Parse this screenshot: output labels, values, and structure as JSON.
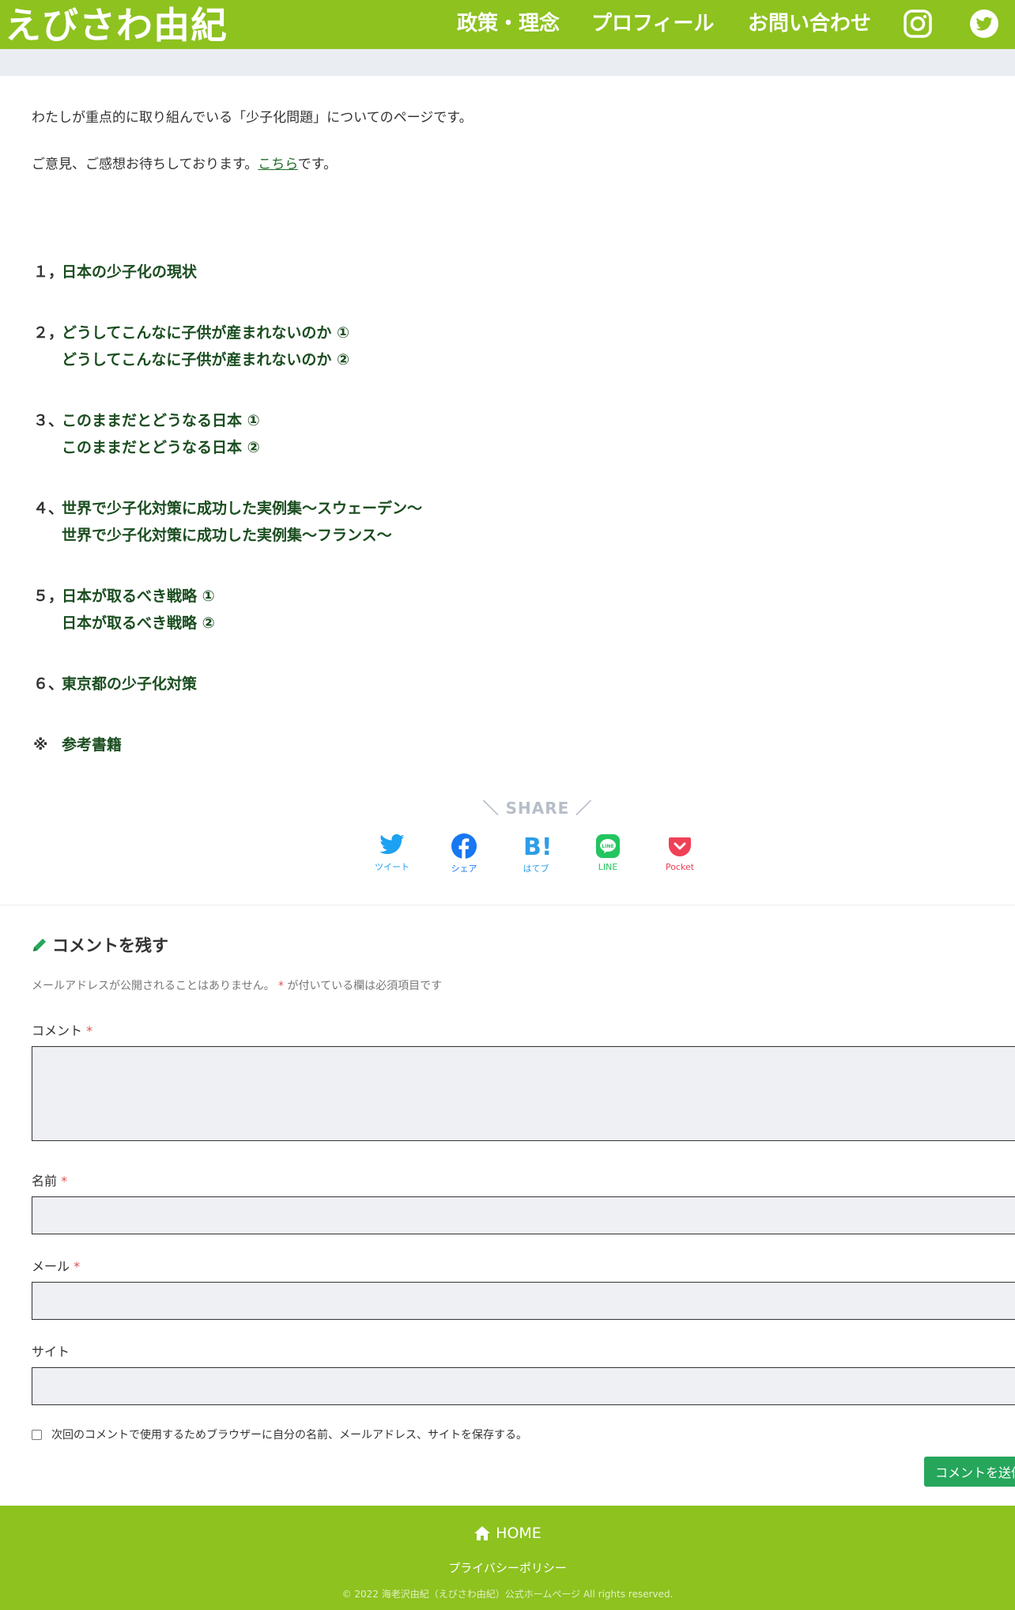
{
  "header": {
    "logo": "えびさわ由紀",
    "nav": [
      {
        "label": "政策・理念"
      },
      {
        "label": "プロフィール"
      },
      {
        "label": "お問い合わせ"
      }
    ],
    "icons": [
      "instagram-icon",
      "twitter-icon"
    ]
  },
  "intro": {
    "line1": "わたしが重点的に取り組んでいる「少子化問題」についてのページです。",
    "line2_before": "ご意見、ご感想お待ちしております。",
    "line2_link": "こちら",
    "line2_after": "です。"
  },
  "toc": [
    {
      "num": "１，",
      "lines": [
        "日本の少子化の現状"
      ]
    },
    {
      "num": "２，",
      "lines": [
        "どうしてこんなに子供が産まれないのか ①",
        "どうしてこんなに子供が産まれないのか ②"
      ]
    },
    {
      "num": "３、",
      "lines": [
        "このままだとどうなる日本 ①",
        "このままだとどうなる日本 ②"
      ]
    },
    {
      "num": "４、",
      "lines": [
        "世界で少子化対策に成功した実例集〜スウェーデン〜",
        "世界で少子化対策に成功した実例集〜フランス〜"
      ]
    },
    {
      "num": "５，",
      "lines": [
        "日本が取るべき戦略 ①",
        "日本が取るべき戦略 ②"
      ]
    },
    {
      "num": "６、",
      "lines": [
        "東京都の少子化対策"
      ]
    },
    {
      "num": "※",
      "lines": [
        "参考書籍"
      ]
    }
  ],
  "share": {
    "title": "SHARE",
    "buttons": [
      {
        "label": "ツイート",
        "color": "#1da1f2",
        "icon": "twitter-icon"
      },
      {
        "label": "シェア",
        "color": "#1877f2",
        "icon": "facebook-icon"
      },
      {
        "label": "はてブ",
        "color": "#2c9de8",
        "icon": "hatena-icon"
      },
      {
        "label": "LINE",
        "color": "#22c55e",
        "icon": "line-icon"
      },
      {
        "label": "Pocket",
        "color": "#ef4056",
        "icon": "pocket-icon"
      }
    ]
  },
  "comment": {
    "title": "コメントを残す",
    "note_before": "メールアドレスが公開されることはありません。",
    "note_req": "*",
    "note_after": " が付いている欄は必須項目です",
    "fields": {
      "comment": {
        "label": "コメント",
        "required": "*",
        "value": ""
      },
      "name": {
        "label": "名前",
        "required": "*",
        "value": ""
      },
      "email": {
        "label": "メール",
        "required": "*",
        "value": ""
      },
      "site": {
        "label": "サイト",
        "value": ""
      }
    },
    "cookie_label": "次回のコメントで使用するためブラウザーに自分の名前、メールアドレス、サイトを保存する。",
    "submit": "コメントを送信"
  },
  "footer": {
    "home": "HOME",
    "privacy": "プライバシーポリシー",
    "copyright": "© 2022 海老沢由紀（えびさわ由紀）公式ホームページ All rights reserved."
  },
  "colors": {
    "brand_green": "#8dc21f",
    "link_green": "#1a4d1f",
    "submit_green": "#26a65b"
  }
}
